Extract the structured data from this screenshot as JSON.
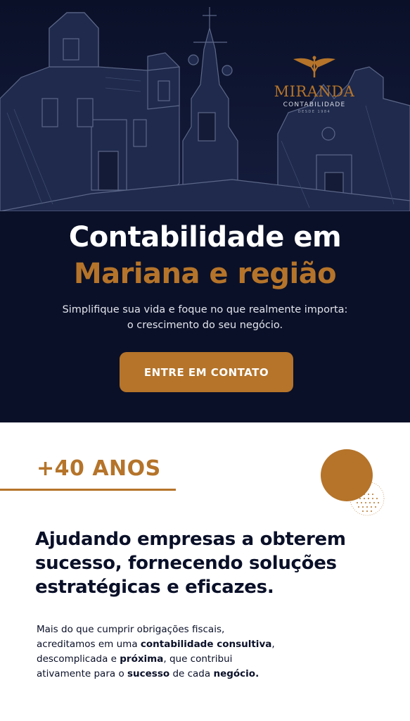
{
  "logo": {
    "name": "MIRANDA",
    "subtitle": "CONTABILIDADE",
    "since": "DESDE 1984"
  },
  "hero": {
    "title_line1": "Contabilidade em",
    "title_line2": "Mariana e região",
    "subtitle_line1": "Simplifique sua vida e foque no que realmente importa:",
    "subtitle_line2": "o crescimento do seu negócio.",
    "cta_label": "ENTRE EM CONTATO"
  },
  "about": {
    "years": "+40 ANOS",
    "headline_line1": "Ajudando empresas a obterem",
    "headline_line2": "sucesso, fornecendo soluções",
    "headline_line3": "estratégicas e eficazes.",
    "body": {
      "l1": "Mais do que cumprir obrigações fiscais,",
      "l2a": "acreditamos em uma ",
      "l2b": "contabilidade consultiva",
      "l2c": ",",
      "l3a": "descomplicada e ",
      "l3b": "próxima",
      "l3c": ", que contribui",
      "l4a": "ativamente para o ",
      "l4b": "sucesso",
      "l4c": " de cada ",
      "l4d": "negócio."
    }
  },
  "colors": {
    "navy": "#0a1028",
    "accent": "#b5742a",
    "white": "#ffffff"
  },
  "icons": {
    "logo_symbol": "caduceus-wings-icon"
  }
}
